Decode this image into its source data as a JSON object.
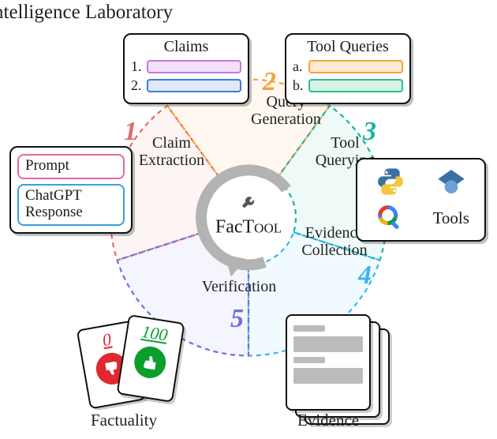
{
  "corner_text": "ntelligence Laboratory",
  "center_name": "FacTool",
  "steps": [
    {
      "num": "1",
      "color": "#e46a6a",
      "label": "Claim\nExtraction"
    },
    {
      "num": "2",
      "color": "#f4a23a",
      "label": "Query\nGeneration"
    },
    {
      "num": "3",
      "color": "#18b5a2",
      "label": "Tool\nQuerying"
    },
    {
      "num": "4",
      "color": "#36b7f2",
      "label": "Evidence\nCollection"
    },
    {
      "num": "5",
      "color": "#6a6fe3",
      "label": "Verification"
    }
  ],
  "prompt_box": {
    "prompt_label": "Prompt",
    "prompt_border": "#e36aa0",
    "response_label": "ChatGPT\nResponse",
    "response_border": "#3aa0e0"
  },
  "claims_box": {
    "title": "Claims",
    "items": [
      {
        "idx": "1.",
        "border": "#c07be6"
      },
      {
        "idx": "2.",
        "border": "#3a7de0"
      }
    ]
  },
  "queries_box": {
    "title": "Tool Queries",
    "items": [
      {
        "idx": "a.",
        "border": "#f5a33a"
      },
      {
        "idx": "b.",
        "border": "#2cbf8e"
      }
    ]
  },
  "tools_box": {
    "label": "Tools"
  },
  "evidence_caption": "Evidence",
  "factuality_caption": "Factuality",
  "factuality_cards": {
    "bad_score": "0",
    "good_score": "100"
  }
}
